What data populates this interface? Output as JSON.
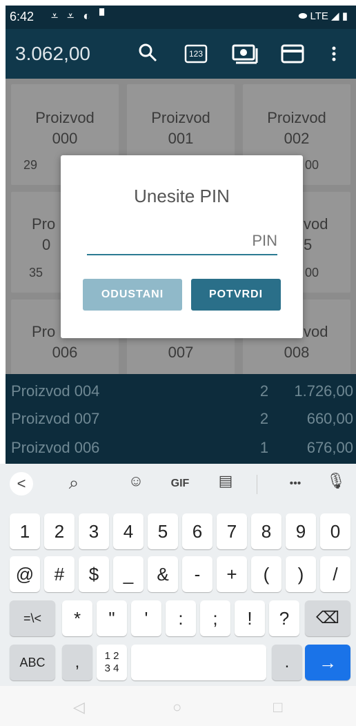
{
  "status": {
    "time": "6:42",
    "icons": "⩡ ⩡ ◐ ▘",
    "right": "⬬ LTE ◢ ▮"
  },
  "appbar": {
    "total": "3.062,00",
    "icons": [
      "search-icon",
      "keypad-123-icon",
      "cash-icon",
      "card-icon",
      "more-icon"
    ],
    "keypad_label": "123"
  },
  "products": [
    {
      "line1": "Proizvod",
      "line2": "000",
      "price": "29"
    },
    {
      "line1": "Proizvod",
      "line2": "001",
      "price": ""
    },
    {
      "line1": "Proizvod",
      "line2": "002",
      "price": "00"
    },
    {
      "line1": "Pro",
      "line2": "0",
      "price": "35"
    },
    {
      "line1": "",
      "line2": "",
      "price": ""
    },
    {
      "line1": "vod",
      "line2": "5",
      "price": "00"
    },
    {
      "line1": "Pro",
      "line2": "006",
      "price": ""
    },
    {
      "line1": "",
      "line2": "007",
      "price": ""
    },
    {
      "line1": "vod",
      "line2": "008",
      "price": ""
    }
  ],
  "cart": [
    {
      "name": "Proizvod 004",
      "qty": "2",
      "amount": "1.726,00"
    },
    {
      "name": "Proizvod 007",
      "qty": "2",
      "amount": "660,00"
    },
    {
      "name": "Proizvod 006",
      "qty": "1",
      "amount": "676,00"
    }
  ],
  "dialog": {
    "title": "Unesite PIN",
    "pin_placeholder": "PIN",
    "cancel": "ODUSTANI",
    "confirm": "POTVRDI"
  },
  "keyboard": {
    "toolbar": {
      "back": "<",
      "search": "⌕",
      "sticker": "☺",
      "gif": "GIF",
      "clipboard": "▤",
      "more": "•••",
      "mic": "🎙"
    },
    "row1": [
      "1",
      "2",
      "3",
      "4",
      "5",
      "6",
      "7",
      "8",
      "9",
      "0"
    ],
    "row2": [
      "@",
      "#",
      "$",
      "_",
      "&",
      "-",
      "+",
      "(",
      ")",
      "/"
    ],
    "row3": [
      "=\\<",
      "*",
      "\"",
      "'",
      ":",
      ";",
      "!",
      "?",
      "⌫"
    ],
    "row4": {
      "abc": "ABC",
      "comma": ",",
      "numpad": "1 2\n3 4",
      "space": "",
      "period": ".",
      "enter": "→"
    }
  },
  "nav": {
    "back": "◁",
    "home": "○",
    "recent": "□"
  }
}
